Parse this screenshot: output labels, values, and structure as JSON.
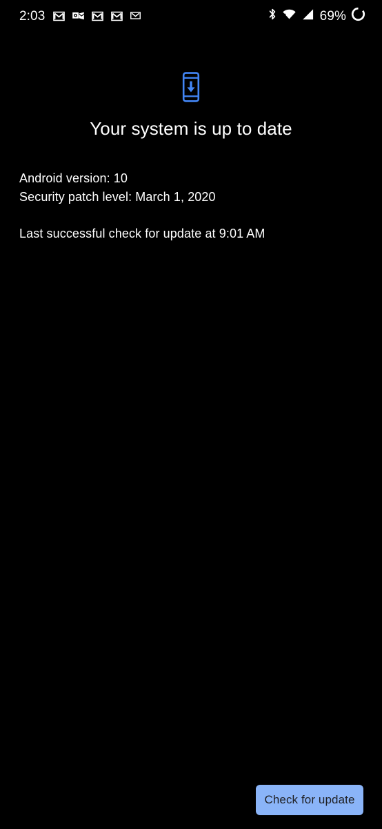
{
  "status_bar": {
    "time": "2:03",
    "battery_percent": "69%",
    "notification_icons": [
      {
        "name": "gmail-icon",
        "label": "Gmail"
      },
      {
        "name": "outlook-icon",
        "label": "Outlook"
      },
      {
        "name": "gmail-icon",
        "label": "Gmail"
      },
      {
        "name": "gmail-icon",
        "label": "Gmail"
      },
      {
        "name": "gmail-icon",
        "label": "Gmail"
      }
    ],
    "system_icons": [
      {
        "name": "bluetooth-icon",
        "label": "Bluetooth"
      },
      {
        "name": "wifi-icon",
        "label": "Wi-Fi"
      },
      {
        "name": "cellular-signal-icon",
        "label": "Cellular signal"
      },
      {
        "name": "battery-charging-icon",
        "label": "Battery charging"
      }
    ]
  },
  "main": {
    "status_icon_name": "phone-download-icon",
    "headline": "Your system is up to date",
    "android_version_line": "Android version: 10",
    "security_patch_line": "Security patch level: March 1, 2020",
    "last_check_line": "Last successful check for update at 9:01 AM"
  },
  "actions": {
    "check_for_update_label": "Check for update"
  },
  "colors": {
    "background": "#000000",
    "text_primary": "#ffffff",
    "accent_blue": "#4285f4",
    "button_background": "#8ab4f8",
    "button_text": "#202124"
  }
}
